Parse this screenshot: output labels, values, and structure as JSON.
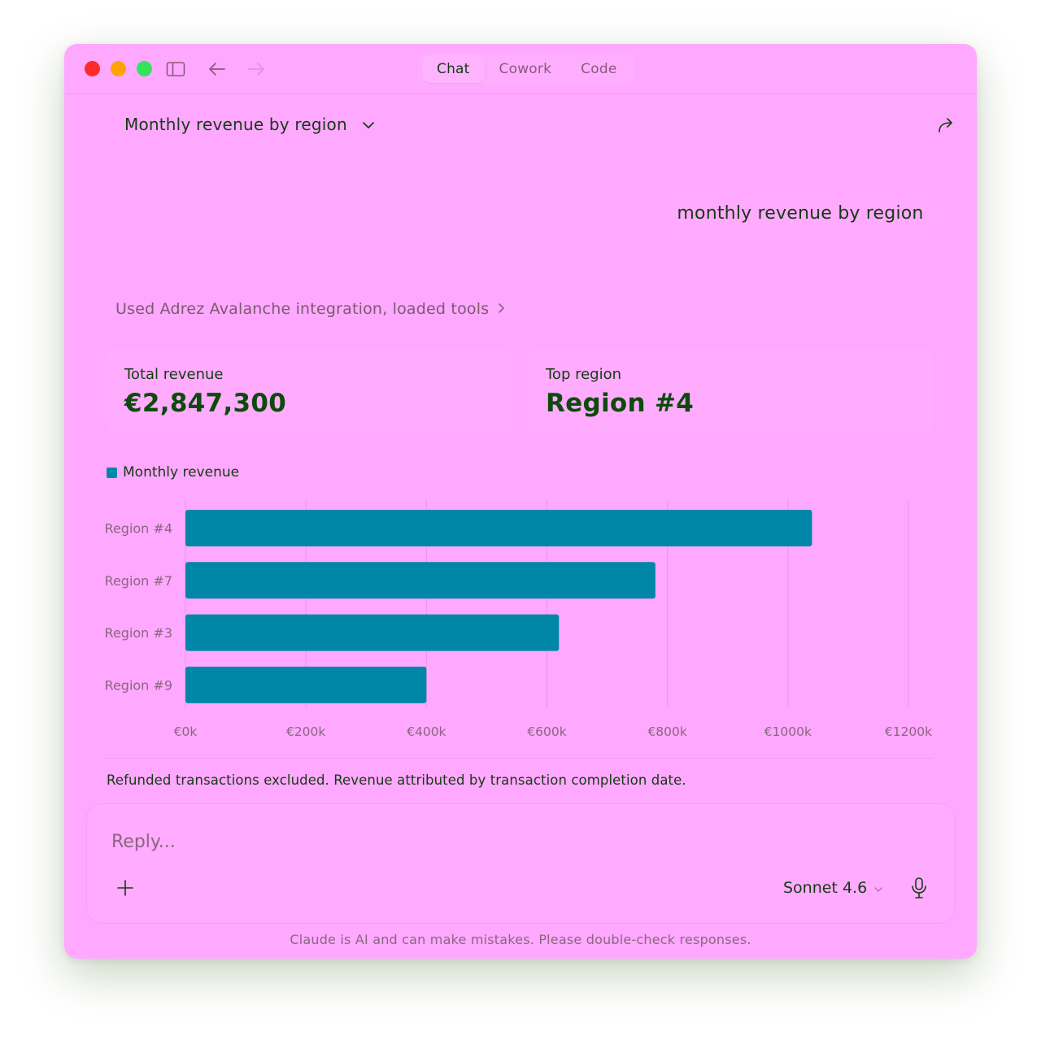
{
  "window": {
    "tabs": [
      {
        "label": "Chat",
        "active": true
      },
      {
        "label": "Cowork",
        "active": false
      },
      {
        "label": "Code",
        "active": false
      }
    ]
  },
  "conversation": {
    "title": "Monthly revenue by region",
    "user_message": "monthly revenue by region",
    "tool_usage": "Used Adrez Avalanche integration, loaded tools"
  },
  "stats": {
    "total_revenue_label": "Total revenue",
    "total_revenue_value": "€2,847,300",
    "top_region_label": "Top region",
    "top_region_value": "Region #4"
  },
  "chart_data": {
    "type": "bar",
    "orientation": "horizontal",
    "categories": [
      "Region #4",
      "Region #7",
      "Region #3",
      "Region #9"
    ],
    "series": [
      {
        "name": "Monthly revenue",
        "values": [
          1040000,
          780000,
          620000,
          400000
        ],
        "color": "#0087a8"
      }
    ],
    "xlim": [
      0,
      1200000
    ],
    "x_ticks": [
      0,
      200000,
      400000,
      600000,
      800000,
      1000000,
      1200000
    ],
    "x_tick_labels": [
      "€0k",
      "€200k",
      "€400k",
      "€600k",
      "€800k",
      "€1000k",
      "€1200k"
    ],
    "grid": true,
    "legend": "top-left",
    "title": "",
    "xlabel": "",
    "ylabel": ""
  },
  "footnote": "Refunded transactions excluded. Revenue attributed by transaction completion date.",
  "composer": {
    "placeholder": "Reply...",
    "model": "Sonnet 4.6"
  },
  "disclaimer": "Claude is AI and can make mistakes. Please double-check responses.",
  "icons": {
    "sidebar": "sidebar-toggle-icon",
    "back": "arrow-left-icon",
    "forward": "arrow-right-icon",
    "chevron": "chevron-down-icon",
    "share": "share-icon",
    "plus": "plus-icon",
    "mic": "microphone-icon"
  },
  "colors": {
    "background": "#ffa8ff",
    "text": "#163a13",
    "accent": "#0087a8"
  }
}
